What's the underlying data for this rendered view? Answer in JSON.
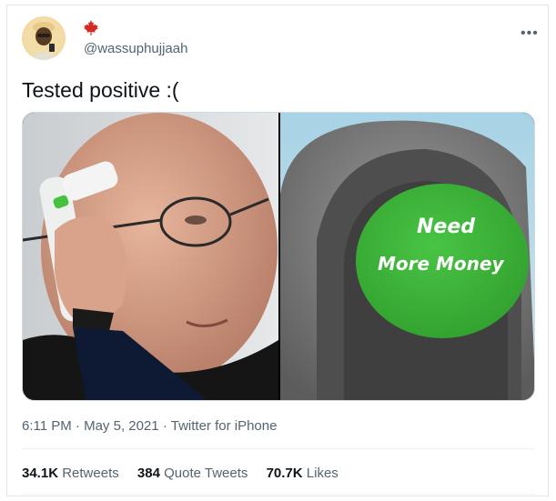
{
  "user": {
    "handle": "@wassuphujjaah",
    "flag_icon": "canada-maple-leaf-icon",
    "avatar_icon": "avatar-person"
  },
  "tweet": {
    "text": "Tested positive :(",
    "image_left_icon": "photo-man-thermometer",
    "image_right_icon": "photo-button-need-more-money",
    "button_text_line1": "Need",
    "button_text_line2": "More Money"
  },
  "meta": {
    "time": "6:11 PM",
    "date": "May 5, 2021",
    "source": "Twitter for iPhone",
    "dot": "·"
  },
  "stats": {
    "retweets_count": "34.1K",
    "retweets_label": "Retweets",
    "quotes_count": "384",
    "quotes_label": "Quote Tweets",
    "likes_count": "70.7K",
    "likes_label": "Likes"
  },
  "more_icon": "ellipsis-icon",
  "colors": {
    "accent_green": "#3db53a",
    "text_secondary": "#536471",
    "maple_red": "#d52b1e"
  }
}
